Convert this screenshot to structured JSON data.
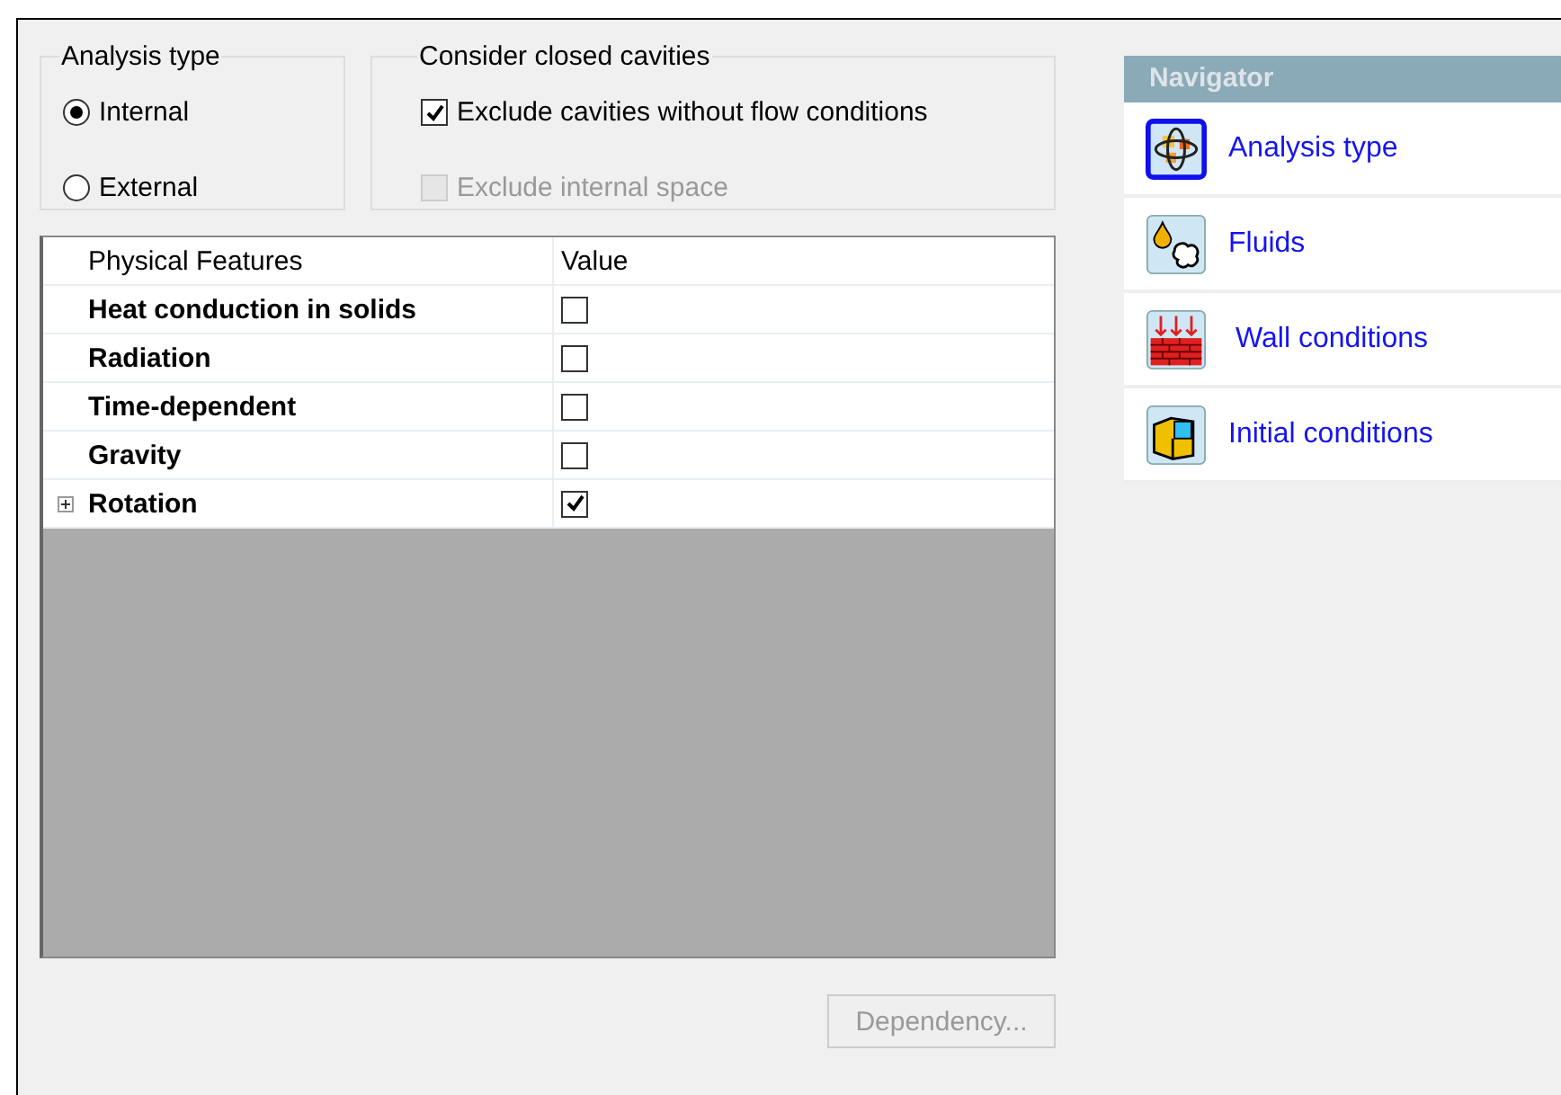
{
  "analysis_type": {
    "title": "Analysis type",
    "options": [
      {
        "label": "Internal",
        "selected": true
      },
      {
        "label": "External",
        "selected": false
      }
    ]
  },
  "closed_cavities": {
    "title": "Consider closed cavities",
    "options": [
      {
        "label": "Exclude cavities without flow conditions",
        "checked": true,
        "disabled": false
      },
      {
        "label": "Exclude internal space",
        "checked": false,
        "disabled": true
      }
    ]
  },
  "table": {
    "columns": [
      "Physical Features",
      "Value"
    ],
    "rows": [
      {
        "feature": "Heat conduction in solids",
        "checked": false,
        "expandable": false
      },
      {
        "feature": "Radiation",
        "checked": false,
        "expandable": false
      },
      {
        "feature": "Time-dependent",
        "checked": false,
        "expandable": false
      },
      {
        "feature": "Gravity",
        "checked": false,
        "expandable": false
      },
      {
        "feature": "Rotation",
        "checked": true,
        "expandable": true
      }
    ]
  },
  "dependency_button": {
    "label": "Dependency...",
    "disabled": true
  },
  "navigator": {
    "title": "Navigator",
    "items": [
      {
        "label": "Analysis type",
        "kind": "analysis",
        "selected": true
      },
      {
        "label": "Fluids",
        "kind": "fluids",
        "selected": false
      },
      {
        "label": "Wall conditions",
        "kind": "wall",
        "selected": false
      },
      {
        "label": "Initial conditions",
        "kind": "initial",
        "selected": false
      }
    ]
  }
}
